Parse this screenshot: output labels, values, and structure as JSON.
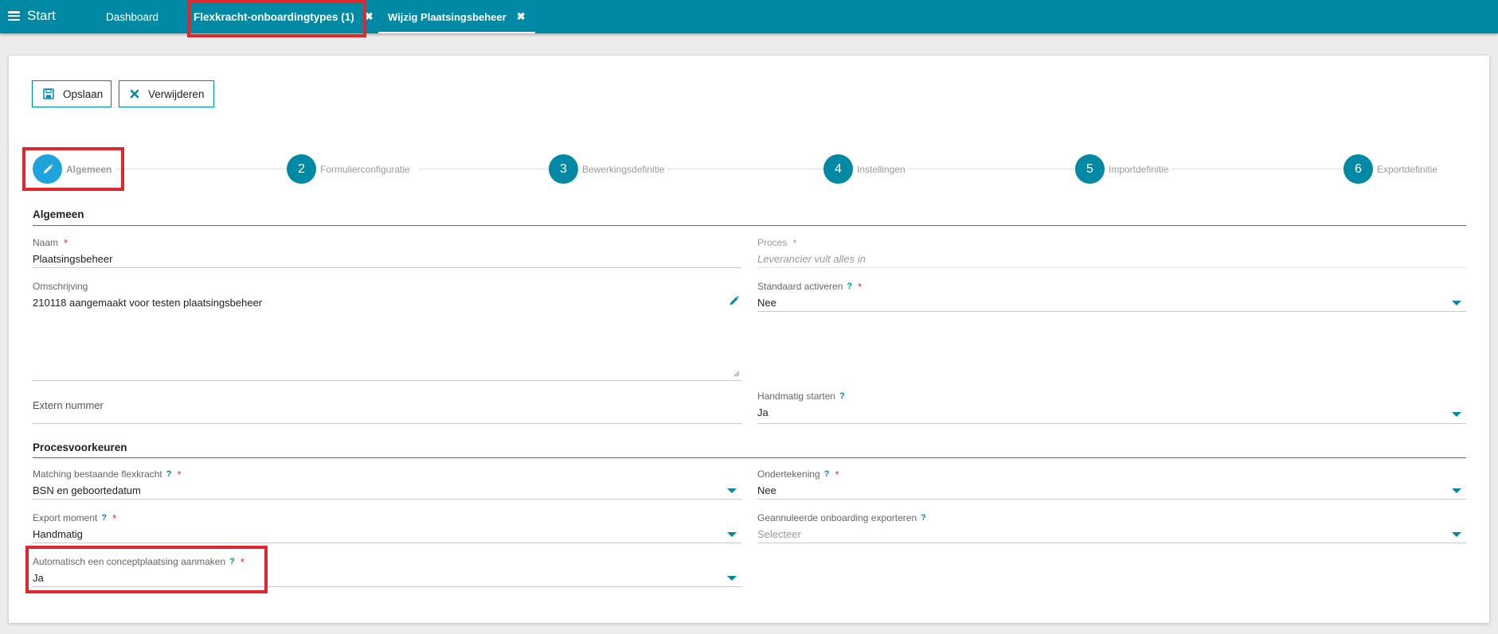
{
  "topbar": {
    "start_label": "Start",
    "tabs": [
      {
        "label": "Dashboard"
      },
      {
        "label": "Flexkracht-onboardingtypes (1)",
        "close": "✖"
      },
      {
        "label": "Wijzig Plaatsingsbeheer",
        "close": "✖"
      }
    ]
  },
  "toolbar": {
    "save_label": "Opslaan",
    "delete_label": "Verwijderen"
  },
  "stepper": [
    {
      "number": "",
      "label": "Algemeen",
      "active": true
    },
    {
      "number": "2",
      "label": "Formulierconfiguratie"
    },
    {
      "number": "3",
      "label": "Bewerkingsdefinitie"
    },
    {
      "number": "4",
      "label": "Instellingen"
    },
    {
      "number": "5",
      "label": "Importdefinitie"
    },
    {
      "number": "6",
      "label": "Exportdefinitie"
    }
  ],
  "sections": {
    "algemeen": "Algemeen",
    "procesvoorkeuren": "Procesvoorkeuren"
  },
  "fields": {
    "naam": {
      "label": "Naam",
      "value": "Plaatsingsbeheer"
    },
    "proces": {
      "label": "Proces",
      "value": "Leverancier vult alles in"
    },
    "omschrijving": {
      "label": "Omschrijving",
      "value": "210118 aangemaakt voor testen plaatsingsbeheer"
    },
    "standaard_activeren": {
      "label": "Standaard activeren",
      "value": "Nee"
    },
    "extern_nummer": {
      "label": "Extern nummer"
    },
    "handmatig_starten": {
      "label": "Handmatig starten",
      "value": "Ja"
    },
    "matching": {
      "label": "Matching bestaande flexkracht",
      "value": "BSN en geboortedatum"
    },
    "ondertekening": {
      "label": "Ondertekening",
      "value": "Nee"
    },
    "export_moment": {
      "label": "Export moment",
      "value": "Handmatig"
    },
    "geannuleerde": {
      "label": "Geannuleerde onboarding exporteren",
      "placeholder": "Selecteer"
    },
    "concept": {
      "label": "Automatisch een conceptplaatsing aanmaken",
      "value": "Ja"
    }
  },
  "markers": {
    "required": "*",
    "help": "?"
  },
  "colors": {
    "accent": "#0089a5",
    "active_step": "#1fa3dc",
    "highlight": "#e1262d",
    "required": "#e1262d"
  }
}
